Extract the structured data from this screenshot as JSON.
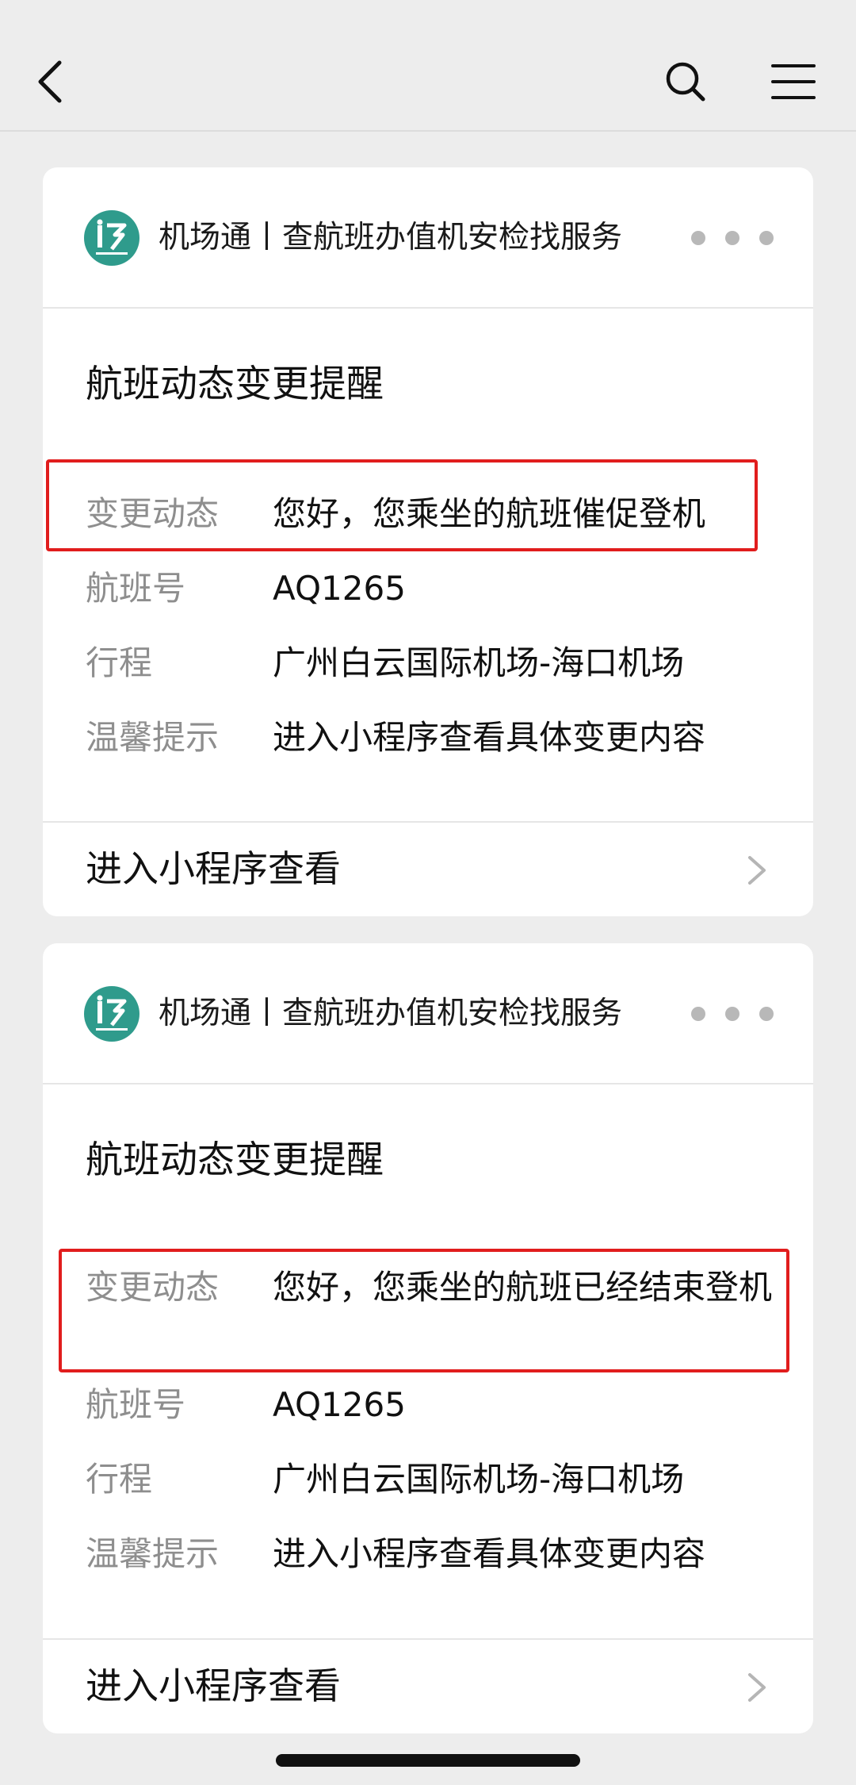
{
  "nav": {
    "back_icon": "back-arrow-icon",
    "search_icon": "search-icon",
    "menu_icon": "menu-icon"
  },
  "cards": [
    {
      "source": "机场通丨查航班办值机安检找服务",
      "title": "航班动态变更提醒",
      "rows": [
        {
          "label": "变更动态",
          "value": "您好，您乘坐的航班催促登机"
        },
        {
          "label": "航班号",
          "value": "AQ1265"
        },
        {
          "label": "行程",
          "value": "广州白云国际机场-海口机场"
        },
        {
          "label": "温馨提示",
          "value": "进入小程序查看具体变更内容"
        }
      ],
      "footer_link": "进入小程序查看"
    },
    {
      "source": "机场通丨查航班办值机安检找服务",
      "title": "航班动态变更提醒",
      "rows": [
        {
          "label": "变更动态",
          "value": "您好，您乘坐的航班已经结束登机"
        },
        {
          "label": "航班号",
          "value": "AQ1265"
        },
        {
          "label": "行程",
          "value": "广州白云国际机场-海口机场"
        },
        {
          "label": "温馨提示",
          "value": "进入小程序查看具体变更内容"
        }
      ],
      "footer_link": "进入小程序查看"
    }
  ],
  "colors": {
    "background": "#ededed",
    "card": "#ffffff",
    "highlight": "#e11d1d",
    "logo": "#2f9b8c",
    "label": "#8e8e8e"
  }
}
